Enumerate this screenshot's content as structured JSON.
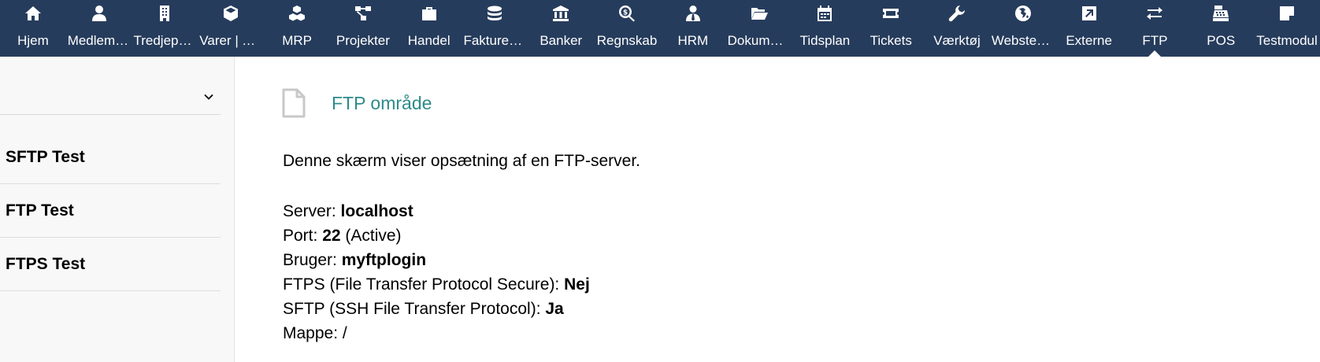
{
  "topmenu": [
    {
      "label": "Hjem",
      "icon": "home-icon"
    },
    {
      "label": "Medlemmer",
      "icon": "user-icon"
    },
    {
      "label": "Tredjeparter",
      "icon": "building-icon"
    },
    {
      "label": "Varer | Ydelser",
      "icon": "cube-icon"
    },
    {
      "label": "MRP",
      "icon": "cubes-icon"
    },
    {
      "label": "Projekter",
      "icon": "project-diagram-icon"
    },
    {
      "label": "Handel",
      "icon": "suitcase-icon"
    },
    {
      "label": "Fakturering",
      "icon": "coins-icon"
    },
    {
      "label": "Banker",
      "icon": "bank-icon"
    },
    {
      "label": "Regnskab",
      "icon": "search-dollar-icon"
    },
    {
      "label": "HRM",
      "icon": "user-tie-icon"
    },
    {
      "label": "Dokumenter",
      "icon": "folder-open-icon"
    },
    {
      "label": "Tidsplan",
      "icon": "calendar-icon"
    },
    {
      "label": "Tickets",
      "icon": "ticket-icon"
    },
    {
      "label": "Værktøj",
      "icon": "wrench-icon"
    },
    {
      "label": "Websteder",
      "icon": "globe-icon"
    },
    {
      "label": "Externe",
      "icon": "external-link-icon"
    },
    {
      "label": "FTP",
      "icon": "exchange-icon",
      "active": true
    },
    {
      "label": "POS",
      "icon": "cash-register-icon"
    },
    {
      "label": "Testmodul",
      "icon": "sticky-note-icon"
    }
  ],
  "sidebar": {
    "select_value": "",
    "items": [
      {
        "label": "SFTP Test"
      },
      {
        "label": "FTP Test"
      },
      {
        "label": "FTPS Test"
      }
    ]
  },
  "main": {
    "title": "FTP område",
    "description": "Denne skærm viser opsætning af en FTP-server.",
    "server_label": "Server: ",
    "server_value": "localhost",
    "port_label": "Port: ",
    "port_value": "22",
    "port_status": " (Active)",
    "user_label": "Bruger: ",
    "user_value": "myftplogin",
    "ftps_label": "FTPS (File Transfer Protocol Secure): ",
    "ftps_value": "Nej",
    "sftp_label": "SFTP (SSH File Transfer Protocol): ",
    "sftp_value": "Ja",
    "folder_label": "Mappe: ",
    "folder_value": "/"
  },
  "colors": {
    "topbar": "#263c5c",
    "title": "#2e8a8a"
  }
}
